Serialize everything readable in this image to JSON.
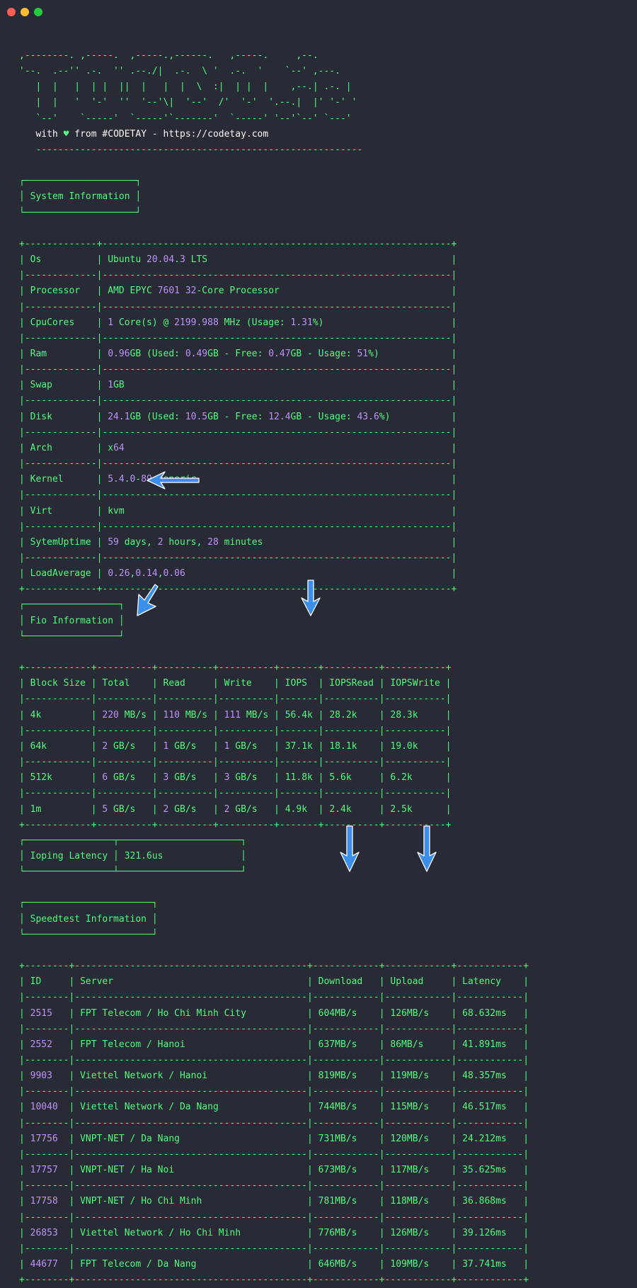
{
  "window": {
    "controls": [
      "close",
      "minimize",
      "maximize"
    ]
  },
  "banner": {
    "ascii": [
      ",--------. ,-----.  ,-----.,------.   ,-----.     ,--.",
      "'--.  .--'' .-.  '' .--./|  .-.  \\ '  .-.  '    `--' ,---.",
      "   |  |   |  | |  ||  |   |  |  \\  :|  | |  |    ,--.| .-. |",
      "   |  |   '  '-'  ''  '--'\\|  '--'  /'  '-'  '.--.|  |' '-' '",
      "   `--'    `-----'  `-----'`-------'  `-----' '--'`--' `---'"
    ],
    "with_text": "   with ",
    "heart_icon": "heart-icon",
    "from_text": " from #CODETAY - https://codetay.com",
    "divider": "   -----------------------------------------------------------"
  },
  "system_information": {
    "title": "System Information",
    "rows": [
      {
        "key": "Os",
        "value": "Ubuntu 20.04.3 LTS"
      },
      {
        "key": "Processor",
        "value": "AMD EPYC 7601 32-Core Processor"
      },
      {
        "key": "CpuCores",
        "value": "1 Core(s) @ 2199.988 MHz (Usage: 1.31%)"
      },
      {
        "key": "Ram",
        "value": "0.96GB (Used: 0.49GB - Free: 0.47GB - Usage: 51%)"
      },
      {
        "key": "Swap",
        "value": "1GB"
      },
      {
        "key": "Disk",
        "value": "24.1GB (Used: 10.5GB - Free: 12.4GB - Usage: 43.6%)"
      },
      {
        "key": "Arch",
        "value": "x64"
      },
      {
        "key": "Kernel",
        "value": "5.4.0-89-generic"
      },
      {
        "key": "Virt",
        "value": "kvm"
      },
      {
        "key": "SytemUptime",
        "value": "59 days, 2 hours, 28 minutes"
      },
      {
        "key": "LoadAverage",
        "value": "0.26,0.14,0.06"
      }
    ]
  },
  "fio_information": {
    "title": "Fio Information",
    "columns": [
      "Block Size",
      "Total",
      "Read",
      "Write",
      "IOPS",
      "IOPSRead",
      "IOPSWrite"
    ],
    "rows": [
      [
        "4k",
        "220 MB/s",
        "110 MB/s",
        "111 MB/s",
        "56.4k",
        "28.2k",
        "28.3k"
      ],
      [
        "64k",
        "2 GB/s",
        "1 GB/s",
        "1 GB/s",
        "37.1k",
        "18.1k",
        "19.0k"
      ],
      [
        "512k",
        "6 GB/s",
        "3 GB/s",
        "3 GB/s",
        "11.8k",
        "5.6k",
        "6.2k"
      ],
      [
        "1m",
        "5 GB/s",
        "2 GB/s",
        "2 GB/s",
        "4.9k",
        "2.4k",
        "2.5k"
      ]
    ]
  },
  "ioping": {
    "label": "Ioping Latency",
    "value": "321.6us"
  },
  "speedtest_information": {
    "title": "Speedtest Information",
    "columns": [
      "ID",
      "Server",
      "Download",
      "Upload",
      "Latency"
    ],
    "rows": [
      [
        "2515",
        "FPT Telecom / Ho Chi Minh City",
        "604MB/s",
        "126MB/s",
        "68.632ms"
      ],
      [
        "2552",
        "FPT Telecom / Hanoi",
        "637MB/s",
        "86MB/s",
        "41.891ms"
      ],
      [
        "9903",
        "Viettel Network / Hanoi",
        "819MB/s",
        "119MB/s",
        "48.357ms"
      ],
      [
        "10040",
        "Viettel Network / Da Nang",
        "744MB/s",
        "115MB/s",
        "46.517ms"
      ],
      [
        "17756",
        "VNPT-NET / Da Nang",
        "731MB/s",
        "120MB/s",
        "24.212ms"
      ],
      [
        "17757",
        "VNPT-NET / Ha Noi",
        "673MB/s",
        "117MB/s",
        "35.625ms"
      ],
      [
        "17758",
        "VNPT-NET / Ho Chi Minh",
        "781MB/s",
        "118MB/s",
        "36.868ms"
      ],
      [
        "26853",
        "Viettel Network / Ho Chi Minh",
        "776MB/s",
        "126MB/s",
        "39.126ms"
      ],
      [
        "44677",
        "FPT Telecom / Da Nang",
        "646MB/s",
        "109MB/s",
        "37.741ms"
      ]
    ]
  },
  "annotations": [
    {
      "icon": "arrow-left-icon",
      "target": "Virt"
    },
    {
      "icon": "arrow-down-left-icon",
      "target": "Total"
    },
    {
      "icon": "arrow-down-icon",
      "target": "IOPS"
    },
    {
      "icon": "arrow-down-icon",
      "target": "Download"
    },
    {
      "icon": "arrow-down-icon",
      "target": "Upload"
    }
  ],
  "colors": {
    "background": "#282a36",
    "text": "#50fa7b",
    "number": "#bd93f9",
    "heart": "#50fa7b",
    "arrow": "#3b8eea"
  }
}
